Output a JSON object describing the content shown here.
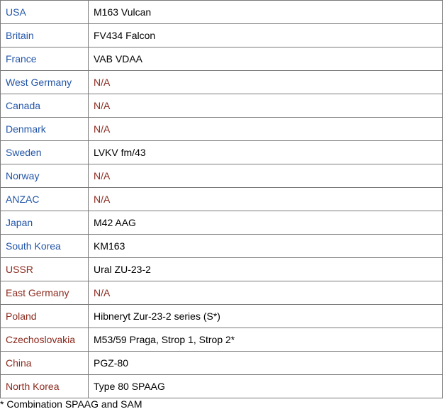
{
  "colors": {
    "nato": "#2255a8",
    "pact": "#8b2a1e",
    "na": "#8b2a1e",
    "text": "#000000"
  },
  "rows": [
    {
      "country": "USA",
      "vehicle": "M163 Vulcan",
      "bloc": "nato",
      "na": false
    },
    {
      "country": "Britain",
      "vehicle": "FV434 Falcon",
      "bloc": "nato",
      "na": false
    },
    {
      "country": "France",
      "vehicle": "VAB VDAA",
      "bloc": "nato",
      "na": false
    },
    {
      "country": "West Germany",
      "vehicle": "N/A",
      "bloc": "nato",
      "na": true
    },
    {
      "country": "Canada",
      "vehicle": "N/A",
      "bloc": "nato",
      "na": true
    },
    {
      "country": "Denmark",
      "vehicle": "N/A",
      "bloc": "nato",
      "na": true
    },
    {
      "country": "Sweden",
      "vehicle": "LVKV fm/43",
      "bloc": "nato",
      "na": false
    },
    {
      "country": "Norway",
      "vehicle": "N/A",
      "bloc": "nato",
      "na": true
    },
    {
      "country": "ANZAC",
      "vehicle": "N/A",
      "bloc": "nato",
      "na": true
    },
    {
      "country": "Japan",
      "vehicle": "M42 AAG",
      "bloc": "nato",
      "na": false
    },
    {
      "country": "South Korea",
      "vehicle": "KM163",
      "bloc": "nato",
      "na": false
    },
    {
      "country": "USSR",
      "vehicle": "Ural ZU-23-2",
      "bloc": "pact",
      "na": false
    },
    {
      "country": "East Germany",
      "vehicle": "N/A",
      "bloc": "pact",
      "na": true
    },
    {
      "country": "Poland",
      "vehicle": "Hibneryt Zur-23-2 series (S*)",
      "bloc": "pact",
      "na": false
    },
    {
      "country": "Czechoslovakia",
      "vehicle": "M53/59 Praga, Strop 1, Strop 2*",
      "bloc": "pact",
      "na": false
    },
    {
      "country": "China",
      "vehicle": "PGZ-80",
      "bloc": "pact",
      "na": false
    },
    {
      "country": "North Korea",
      "vehicle": "Type 80 SPAAG",
      "bloc": "pact",
      "na": false
    }
  ],
  "footnote": "* Combination SPAAG and SAM"
}
